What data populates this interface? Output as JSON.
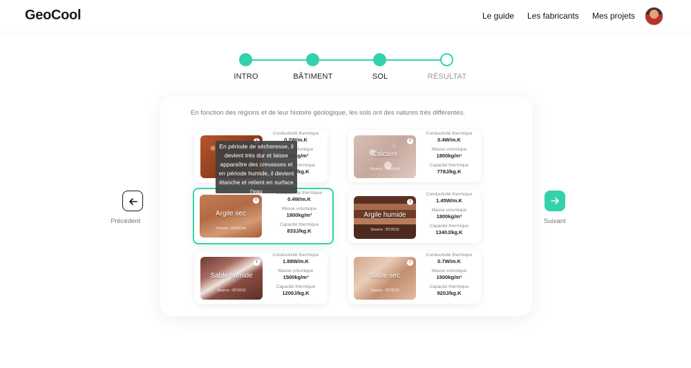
{
  "header": {
    "logo": "GeoCool",
    "nav": [
      "Le guide",
      "Les fabricants",
      "Mes projets"
    ],
    "avatar_icon": "user-avatar"
  },
  "stepper": {
    "steps": [
      {
        "label": "INTRO",
        "state": "done"
      },
      {
        "label": "BÂTIMENT",
        "state": "done"
      },
      {
        "label": "SOL",
        "state": "current"
      },
      {
        "label": "RÉSULTAT",
        "state": "todo"
      }
    ],
    "accent": "#33d1ac"
  },
  "intro_text": "En fonction des régions et de leur histoire géologique, les sols ont des natures très différentes.",
  "labels": {
    "conductivity": "Conductivité thermique",
    "density": "Masse volumique",
    "capacity": "Capacité thermique"
  },
  "soils": [
    {
      "name": "",
      "source": "",
      "conductivity": "0.2W/m.K",
      "density": "1800kg/m³",
      "capacity": "1250J/kg.K",
      "texture": "rust"
    },
    {
      "name": "Calcaire",
      "source": "Source : GeoCool",
      "conductivity": "0.4W/m.K",
      "density": "1800kg/m³",
      "capacity": "778J/kg.K",
      "texture": "calc"
    },
    {
      "name": "Argile sec",
      "source": "Source : GeoCool",
      "conductivity": "0.4W/m.K",
      "density": "1800kg/m³",
      "capacity": "833J/kg.K",
      "texture": "argsec",
      "selected": true
    },
    {
      "name": "Argile humide",
      "source": "Source : RT2012",
      "conductivity": "1.45W/m.K",
      "density": "1800kg/m³",
      "capacity": "1340J/kg.K",
      "texture": "arghum"
    },
    {
      "name": "Sable humide",
      "source": "Source : RT2012",
      "conductivity": "1.88W/m.K",
      "density": "1500kg/m³",
      "capacity": "1200J/kg.K",
      "texture": "sablehum"
    },
    {
      "name": "Sable sec",
      "source": "Source : RT2012",
      "conductivity": "0.7W/m.K",
      "density": "1500kg/m³",
      "capacity": "920J/kg.K",
      "texture": "sablesec"
    }
  ],
  "tooltip": "En période de sécheresse, il devient très dur et laisse apparaître des crevasses et en période humide, il devient étanche et retient en surface l'eau",
  "navigation": {
    "prev_label": "Précédent",
    "next_label": "Suivant"
  }
}
